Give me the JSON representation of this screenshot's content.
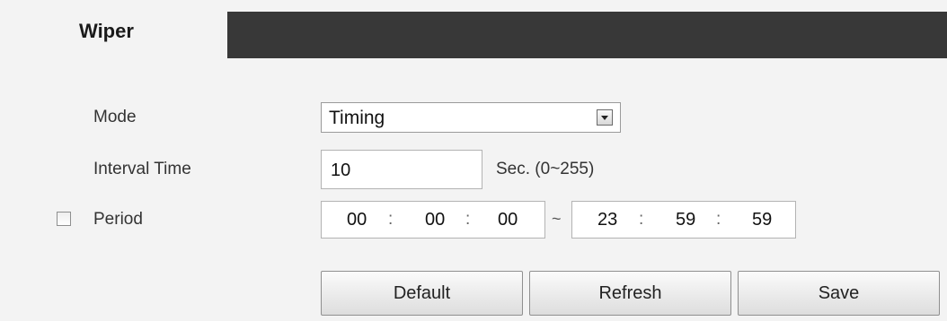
{
  "tabs": [
    {
      "label": "Wiper",
      "active": true
    }
  ],
  "form": {
    "mode": {
      "label": "Mode",
      "value": "Timing"
    },
    "interval": {
      "label": "Interval Time",
      "value": "10",
      "hint": "Sec. (0~255)"
    },
    "period": {
      "label": "Period",
      "checked": false,
      "start": {
        "h": "00",
        "m": "00",
        "s": "00"
      },
      "end": {
        "h": "23",
        "m": "59",
        "s": "59"
      },
      "time_separator": ":",
      "range_separator": "~"
    }
  },
  "buttons": {
    "default": "Default",
    "refresh": "Refresh",
    "save": "Save"
  },
  "colors": {
    "tab_bar": "#383838",
    "background": "#f3f3f3"
  }
}
